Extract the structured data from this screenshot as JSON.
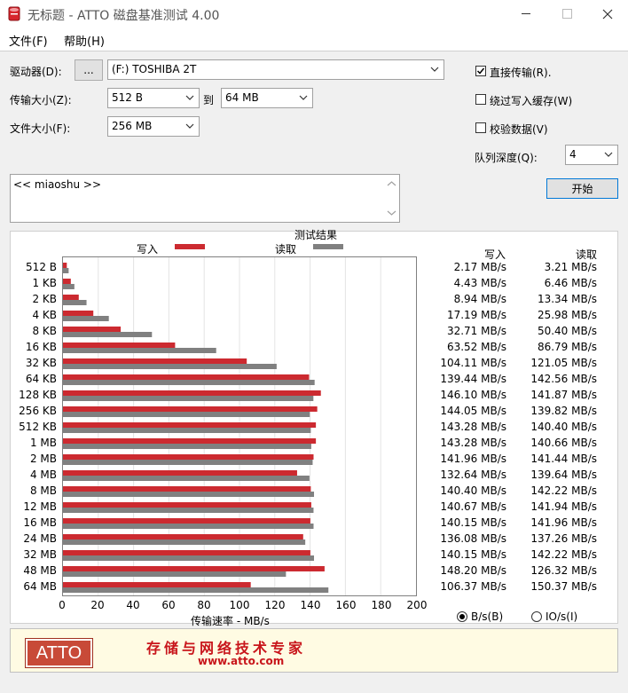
{
  "window": {
    "title": "无标题 - ATTO 磁盘基准测试 4.00"
  },
  "menu": {
    "file": "文件(F)",
    "help": "帮助(H)"
  },
  "form": {
    "drive_label": "驱动器(D):",
    "browse_label": "...",
    "drive_value": "(F:) TOSHIBA 2T",
    "transfer_label": "传输大小(Z):",
    "transfer_from": "512 B",
    "to_label": "到",
    "transfer_to": "64 MB",
    "filesize_label": "文件大小(F):",
    "filesize_value": "256 MB"
  },
  "options": {
    "direct_io": {
      "label": "直接传输(R).",
      "checked": true
    },
    "bypass_cache": {
      "label": "绕过写入缓存(W)",
      "checked": false
    },
    "verify": {
      "label": "校验数据(V)",
      "checked": false
    },
    "queue_label": "队列深度(Q):",
    "queue_value": "4",
    "start_label": "开始"
  },
  "description": {
    "text": "<< miaoshu >>"
  },
  "results": {
    "panel_title": "测试结果",
    "legend_write": "写入",
    "legend_read": "读取",
    "col_write": "写入",
    "col_read": "读取",
    "xlabel": "传输速率 - MB/s",
    "unit_bytes": "B/s(B)",
    "unit_io": "IO/s(I)",
    "unit_selected": "bytes"
  },
  "colors": {
    "write": "#cc2a30",
    "read": "#808080"
  },
  "chart_data": {
    "type": "bar",
    "orientation": "horizontal",
    "xlabel": "传输速率 - MB/s",
    "xlim": [
      0,
      200
    ],
    "xticks": [
      "0",
      "20",
      "40",
      "60",
      "80",
      "100",
      "120",
      "140",
      "160",
      "180",
      "200"
    ],
    "categories": [
      "512 B",
      "1 KB",
      "2 KB",
      "4 KB",
      "8 KB",
      "16 KB",
      "32 KB",
      "64 KB",
      "128 KB",
      "256 KB",
      "512 KB",
      "1 MB",
      "2 MB",
      "4 MB",
      "8 MB",
      "12 MB",
      "16 MB",
      "24 MB",
      "32 MB",
      "48 MB",
      "64 MB"
    ],
    "series": [
      {
        "name": "写入",
        "values": [
          2.17,
          4.43,
          8.94,
          17.19,
          32.71,
          63.52,
          104.11,
          139.44,
          146.1,
          144.05,
          143.28,
          143.28,
          141.96,
          132.64,
          140.4,
          140.67,
          140.15,
          136.08,
          140.15,
          148.2,
          106.37
        ],
        "labels": [
          "2.17 MB/s",
          "4.43 MB/s",
          "8.94 MB/s",
          "17.19 MB/s",
          "32.71 MB/s",
          "63.52 MB/s",
          "104.11 MB/s",
          "139.44 MB/s",
          "146.10 MB/s",
          "144.05 MB/s",
          "143.28 MB/s",
          "143.28 MB/s",
          "141.96 MB/s",
          "132.64 MB/s",
          "140.40 MB/s",
          "140.67 MB/s",
          "140.15 MB/s",
          "136.08 MB/s",
          "140.15 MB/s",
          "148.20 MB/s",
          "106.37 MB/s"
        ]
      },
      {
        "name": "读取",
        "values": [
          3.21,
          6.46,
          13.34,
          25.98,
          50.4,
          86.79,
          121.05,
          142.56,
          141.87,
          139.82,
          140.4,
          140.66,
          141.44,
          139.64,
          142.22,
          141.94,
          141.96,
          137.26,
          142.22,
          126.32,
          150.37
        ],
        "labels": [
          "3.21 MB/s",
          "6.46 MB/s",
          "13.34 MB/s",
          "25.98 MB/s",
          "50.40 MB/s",
          "86.79 MB/s",
          "121.05 MB/s",
          "142.56 MB/s",
          "141.87 MB/s",
          "139.82 MB/s",
          "140.40 MB/s",
          "140.66 MB/s",
          "141.44 MB/s",
          "139.64 MB/s",
          "142.22 MB/s",
          "141.94 MB/s",
          "141.96 MB/s",
          "137.26 MB/s",
          "142.22 MB/s",
          "126.32 MB/s",
          "150.37 MB/s"
        ]
      }
    ]
  },
  "banner": {
    "logo": "ATTO",
    "slogan": "存储与网络技术专家",
    "url": "www.atto.com"
  }
}
